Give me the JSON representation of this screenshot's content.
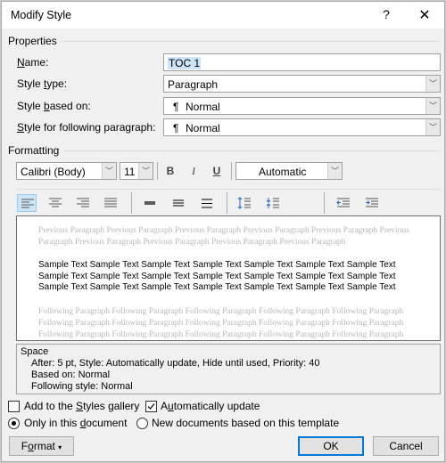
{
  "window": {
    "title": "Modify Style",
    "help_label": "?",
    "close_label": "✕"
  },
  "properties": {
    "section_label": "Properties",
    "name": {
      "label_prefix": "",
      "label_ul": "N",
      "label_rest": "ame:",
      "value": "TOC 1"
    },
    "style_type": {
      "label_prefix": "Style ",
      "label_ul": "t",
      "label_rest": "ype:",
      "value": "Paragraph"
    },
    "based_on": {
      "label_prefix": "Style ",
      "label_ul": "b",
      "label_rest": "ased on:",
      "value": "Normal",
      "icon": "¶"
    },
    "following": {
      "label_prefix": "",
      "label_ul": "S",
      "label_rest": "tyle for following paragraph:",
      "value": "Normal",
      "icon": "¶"
    }
  },
  "formatting": {
    "section_label": "Formatting",
    "font": "Calibri (Body)",
    "size": "11",
    "bold": "B",
    "italic": "I",
    "underline": "U",
    "color": "Automatic",
    "icons": [
      "align-left-icon",
      "align-center-icon",
      "align-right-icon",
      "justify-icon",
      "single-spacing-icon",
      "one-half-spacing-icon",
      "double-spacing-icon",
      "increase-paragraph-spacing-icon",
      "decrease-paragraph-spacing-icon",
      "decrease-indent-icon",
      "increase-indent-icon"
    ],
    "active_alignment": "align-left"
  },
  "preview": {
    "previous": [
      "Previous Paragraph Previous Paragraph Previous Paragraph Previous Paragraph Previous Paragraph Previous",
      "Paragraph Previous Paragraph Previous Paragraph Previous Paragraph Previous Paragraph"
    ],
    "sample": [
      "Sample Text Sample Text Sample Text Sample Text Sample Text Sample Text Sample Text",
      "Sample Text Sample Text Sample Text Sample Text Sample Text Sample Text Sample Text",
      "Sample Text Sample Text Sample Text Sample Text Sample Text Sample Text Sample Text"
    ],
    "following": [
      "Following Paragraph Following Paragraph Following Paragraph Following Paragraph Following Paragraph",
      "Following Paragraph Following Paragraph Following Paragraph Following Paragraph Following Paragraph",
      "Following Paragraph Following Paragraph Following Paragraph Following Paragraph Following Paragraph"
    ]
  },
  "description": {
    "line1": "Space",
    "line2": "After:  5 pt, Style: Automatically update, Hide until used, Priority: 40",
    "line3": "Based on: Normal",
    "line4": "Following style: Normal"
  },
  "options": {
    "add_gallery": {
      "pre": "Add to the ",
      "ul": "S",
      "post": "tyles gallery",
      "checked": false
    },
    "auto_update": {
      "pre": "A",
      "ul": "u",
      "post": "tomatically update",
      "checked": true
    },
    "only_doc": {
      "pre": "Only in this ",
      "ul": "d",
      "post": "ocument",
      "selected": true
    },
    "new_docs": {
      "label": "New documents based on this template",
      "selected": false
    }
  },
  "buttons": {
    "format_pre": "F",
    "format_ul": "o",
    "format_post": "rmat",
    "ok": "OK",
    "cancel": "Cancel"
  }
}
